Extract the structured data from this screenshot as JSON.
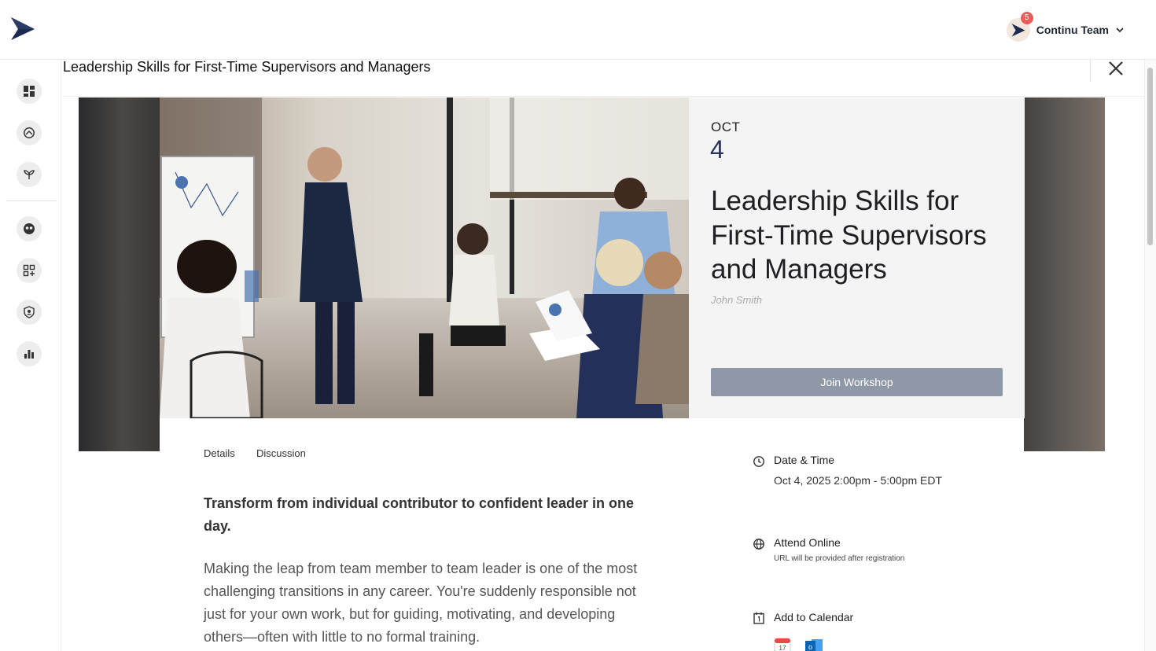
{
  "header": {
    "logo_icon": "continu-logo-icon",
    "user": {
      "name": "Continu Team",
      "notification_count": "5"
    }
  },
  "sidebar": {
    "items": [
      {
        "name": "dashboard",
        "icon": "dashboard-icon"
      },
      {
        "name": "explore",
        "icon": "compass-icon"
      },
      {
        "name": "learning",
        "icon": "sprout-icon"
      },
      {
        "name": "community",
        "icon": "people-icon"
      },
      {
        "name": "apps",
        "icon": "apps-icon"
      },
      {
        "name": "admin",
        "icon": "shield-user-icon"
      },
      {
        "name": "analytics",
        "icon": "bar-chart-icon"
      }
    ]
  },
  "modal": {
    "title": "Leadership Skills for First-Time Supervisors and Managers",
    "close_icon": "close-icon"
  },
  "event": {
    "month": "OCT",
    "day": "4",
    "title": "Leadership Skills for First-Time Supervisors and Managers",
    "author": "John Smith",
    "join_label": "Join Workshop"
  },
  "tabs": [
    {
      "label": "Details"
    },
    {
      "label": "Discussion"
    }
  ],
  "description": {
    "lead": "Transform from individual contributor to confident leader in one day.",
    "body": "Making the leap from team member to team leader is one of the most challenging transitions in any career. You're suddenly responsible not just for your own work, but for guiding, motivating, and developing others—often with little to no formal training."
  },
  "details": {
    "date_label": "Date & Time",
    "date_value": "Oct 4, 2025 2:00pm - 5:00pm EDT",
    "location_label": "Attend Online",
    "location_note": "URL will be provided after registration",
    "calendar_label": "Add to Calendar",
    "calendar_options": [
      "apple-calendar-icon",
      "outlook-icon"
    ]
  },
  "colors": {
    "accent_navy": "#26325c",
    "join_button": "#8e98a6",
    "badge": "#ef5b5b"
  }
}
